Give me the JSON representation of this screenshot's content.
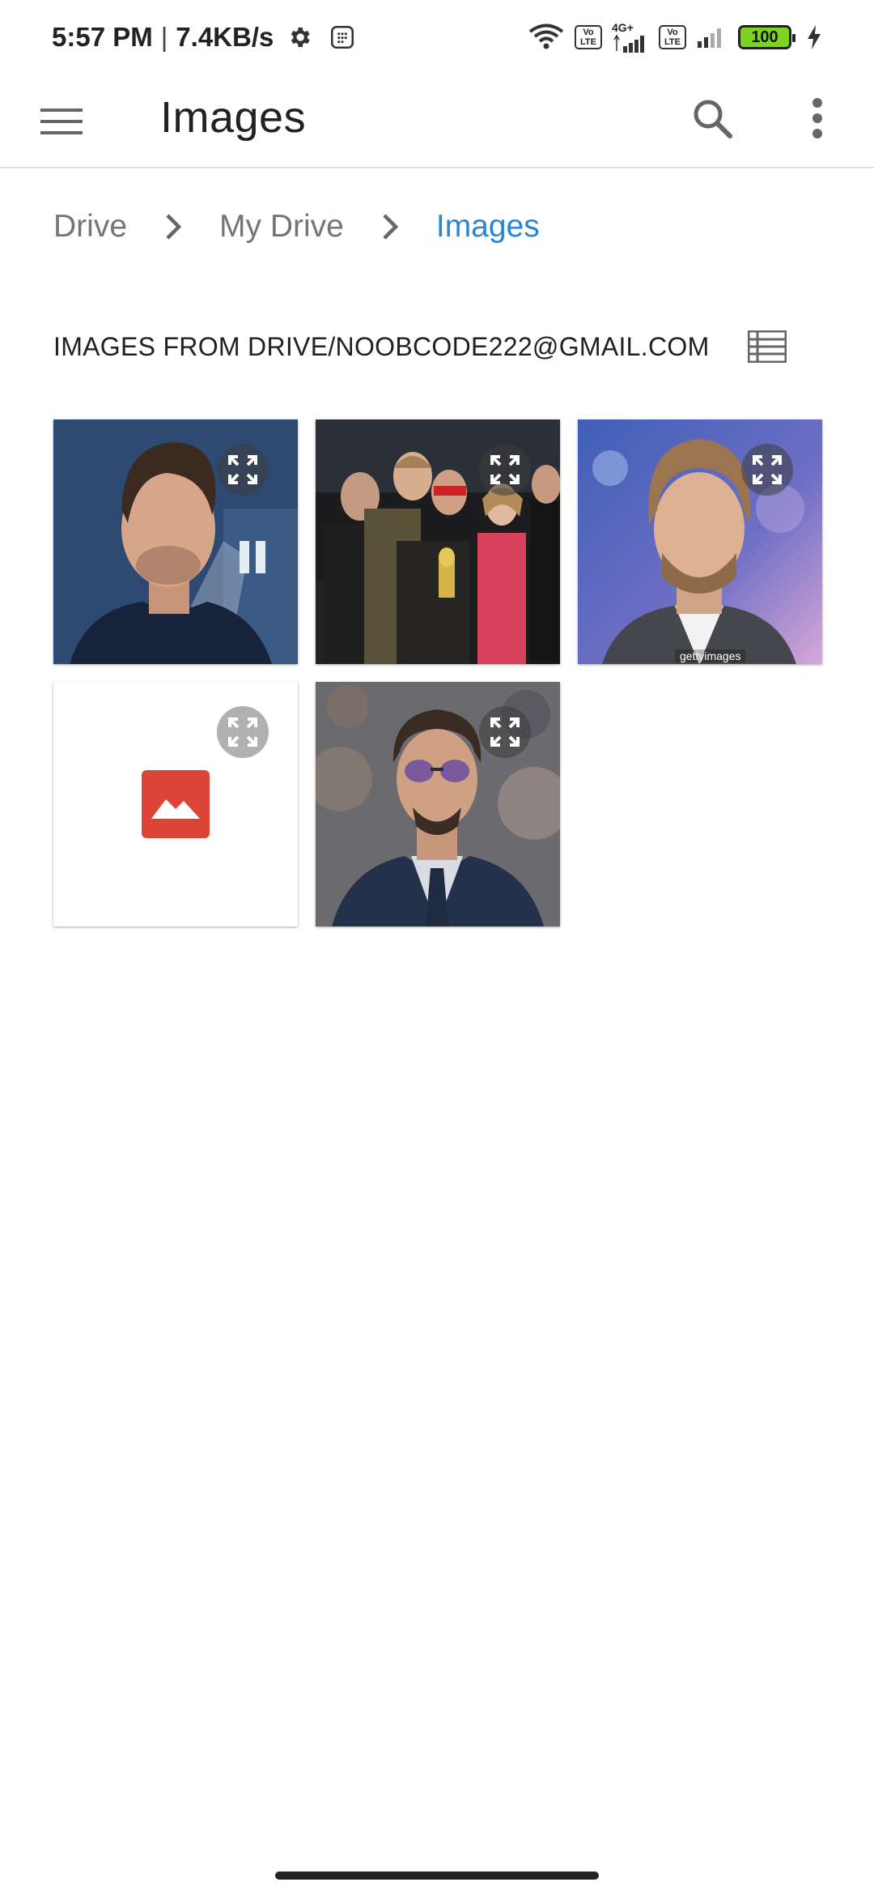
{
  "status": {
    "time": "5:57 PM",
    "speed": "7.4KB/s",
    "network_type": "4G+",
    "volte_top": "Vo",
    "volte_bottom": "LTE",
    "battery": "100"
  },
  "appbar": {
    "title": "Images",
    "menu_icon": "hamburger-menu-icon",
    "search_icon": "search-icon",
    "more_icon": "more-vert-icon"
  },
  "breadcrumb": [
    {
      "label": "Drive"
    },
    {
      "label": "My Drive"
    },
    {
      "label": "Images"
    }
  ],
  "section": {
    "label": "IMAGES FROM DRIVE/NOOBCODE222@GMAIL.COM",
    "view_icon": "list-view-icon"
  },
  "images": [
    {
      "name": "photo-man-blue-backdrop",
      "watermark": ""
    },
    {
      "name": "photo-group-event",
      "watermark": ""
    },
    {
      "name": "photo-man-purple-backdrop",
      "watermark": "gettyimages"
    },
    {
      "name": "image-placeholder",
      "watermark": ""
    },
    {
      "name": "photo-man-sunglasses",
      "watermark": ""
    }
  ],
  "colors": {
    "accent": "#2a84d8",
    "placeholder_red": "#db4437"
  }
}
